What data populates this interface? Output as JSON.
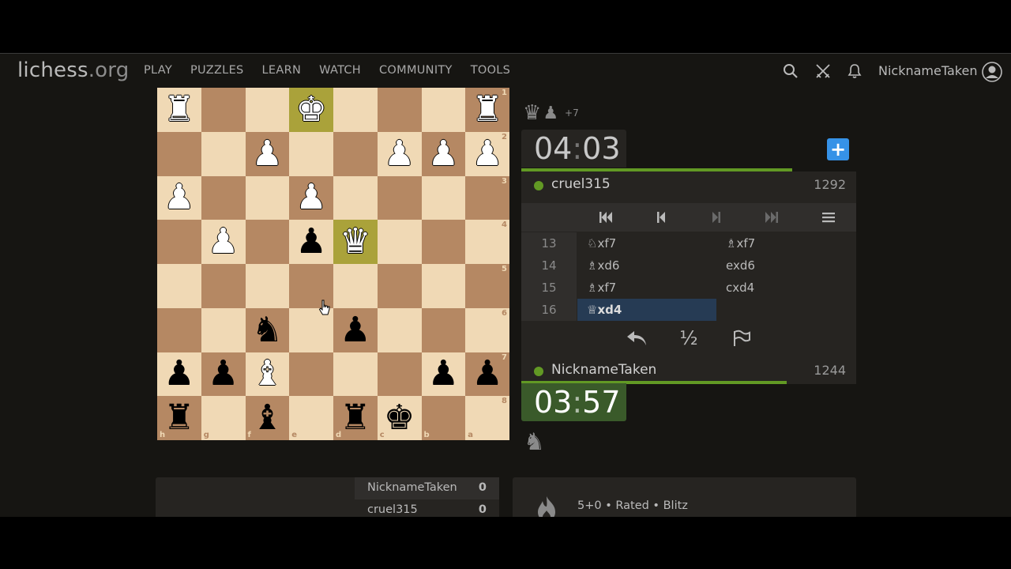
{
  "header": {
    "logo_main": "lichess",
    "logo_tld": ".org",
    "nav": [
      "PLAY",
      "PUZZLES",
      "LEARN",
      "WATCH",
      "COMMUNITY",
      "TOOLS"
    ],
    "username": "NicknameTaken",
    "icons": [
      "search-icon",
      "swords-icon",
      "bell-icon",
      "user-avatar-icon"
    ]
  },
  "board": {
    "orientation": "black",
    "light_color": "#f0d9b5",
    "dark_color": "#b58863",
    "highlight_color": "#cdd26a",
    "ranks": [
      "1",
      "2",
      "3",
      "4",
      "5",
      "6",
      "7",
      "8"
    ],
    "files": [
      "h",
      "g",
      "f",
      "e",
      "d",
      "c",
      "b",
      "a"
    ],
    "rows": [
      [
        "wR",
        "",
        "",
        "wK",
        "",
        "",
        "",
        "wR"
      ],
      [
        "",
        "",
        "wP",
        "",
        "",
        "wP",
        "wP",
        "wP"
      ],
      [
        "wP",
        "",
        "",
        "wP",
        "",
        "",
        "",
        ""
      ],
      [
        "",
        "wP",
        "",
        "bP",
        "wQ",
        "",
        "",
        ""
      ],
      [
        "",
        "",
        "",
        "",
        "",
        "",
        "",
        ""
      ],
      [
        "",
        "",
        "bN",
        "",
        "bP",
        "",
        "",
        ""
      ],
      [
        "bP",
        "bP",
        "wB",
        "",
        "",
        "",
        "bP",
        "bP"
      ],
      [
        "bR",
        "",
        "bB",
        "",
        "bR",
        "bK",
        "",
        ""
      ]
    ],
    "highlighted": [
      "e1",
      "d4"
    ]
  },
  "material_top": {
    "pieces": [
      "white-queen-icon",
      "white-pawn-icon"
    ],
    "advantage": "+7"
  },
  "clock_top": {
    "minutes": "04",
    "seconds": "03"
  },
  "clock_bottom": {
    "minutes": "03",
    "seconds": "57"
  },
  "player_top": {
    "name": "cruel315",
    "rating": "1292"
  },
  "player_bottom": {
    "name": "NicknameTaken",
    "rating": "1244"
  },
  "moves": [
    {
      "num": "13",
      "white": "♘xf7",
      "black": "♗xf7"
    },
    {
      "num": "14",
      "white": "♗xd6",
      "black": "exd6"
    },
    {
      "num": "15",
      "white": "♗xf7",
      "black": "cxd4"
    },
    {
      "num": "16",
      "white": "♕xd4",
      "black": ""
    }
  ],
  "current_move": "♕xd4",
  "actions": {
    "draw_label": "½"
  },
  "crosstable": [
    {
      "name": "NicknameTaken",
      "score": "0"
    },
    {
      "name": "cruel315",
      "score": "0"
    }
  ],
  "game_info": {
    "text": "5+0 • Rated • Blitz"
  },
  "colors": {
    "accent": "#629924",
    "active_move": "#263b54",
    "plus_button": "#3692e7"
  }
}
